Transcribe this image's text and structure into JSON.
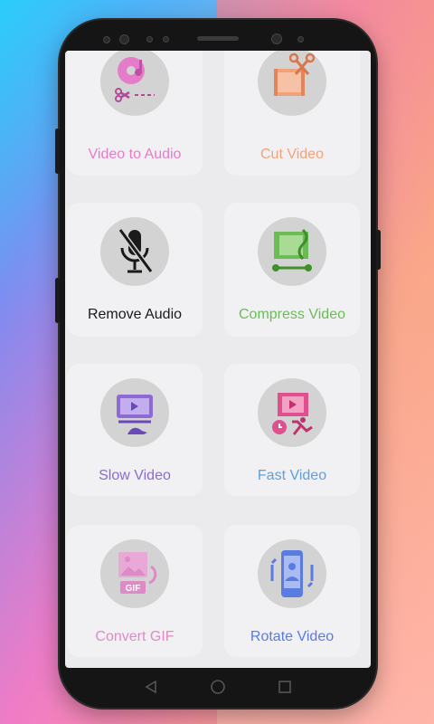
{
  "cards": [
    {
      "label": "Video to Audio",
      "color": "#e57cc9",
      "icon": "music-disc-scissors-icon"
    },
    {
      "label": "Cut Video",
      "color": "#f2a27a",
      "icon": "film-scissors-icon"
    },
    {
      "label": "Remove Audio",
      "color": "#1a1a1a",
      "icon": "mic-off-icon"
    },
    {
      "label": "Compress Video",
      "color": "#6cbc55",
      "icon": "compress-film-icon"
    },
    {
      "label": "Slow Video",
      "color": "#8d6ad1",
      "icon": "slow-video-turtle-icon"
    },
    {
      "label": "Fast Video",
      "color": "#5e9fe0",
      "icon": "fast-video-runner-icon"
    },
    {
      "label": "Convert GIF",
      "color": "#de8ac6",
      "icon": "gif-image-icon"
    },
    {
      "label": "Rotate Video",
      "color": "#5a7be0",
      "icon": "rotate-phone-icon"
    }
  ],
  "navbar": {
    "back_icon": "back-triangle-icon",
    "home_icon": "home-circle-icon",
    "recents_icon": "recents-square-icon"
  }
}
